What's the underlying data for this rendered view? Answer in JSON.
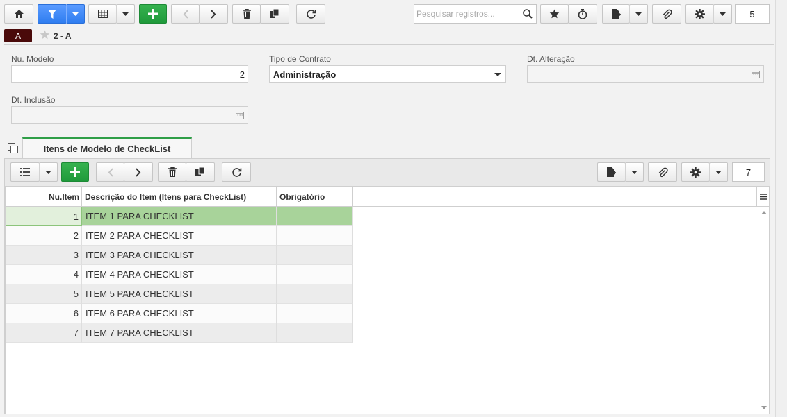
{
  "toolbar": {
    "search_placeholder": "Pesquisar registros...",
    "record_count": "5"
  },
  "record": {
    "tag": "A",
    "title": "2 - A"
  },
  "form": {
    "nu_modelo_label": "Nu. Modelo",
    "nu_modelo_value": "2",
    "tipo_contrato_label": "Tipo de Contrato",
    "tipo_contrato_value": "Administração",
    "dt_alteracao_label": "Dt. Alteração",
    "dt_alteracao_value": "",
    "dt_inclusao_label": "Dt. Inclusão",
    "dt_inclusao_value": ""
  },
  "subtab": {
    "label": "Itens de Modelo de CheckList",
    "record_count": "7"
  },
  "grid": {
    "columns": [
      "Nu.Item",
      "Descrição do Item (Itens para CheckList)",
      "Obrigatório"
    ],
    "rows": [
      {
        "num": "1",
        "desc": "ITEM 1 PARA CHECKLIST",
        "obrig": ""
      },
      {
        "num": "2",
        "desc": "ITEM 2 PARA CHECKLIST",
        "obrig": ""
      },
      {
        "num": "3",
        "desc": "ITEM 3 PARA CHECKLIST",
        "obrig": ""
      },
      {
        "num": "4",
        "desc": "ITEM 4 PARA CHECKLIST",
        "obrig": ""
      },
      {
        "num": "5",
        "desc": "ITEM 5 PARA CHECKLIST",
        "obrig": ""
      },
      {
        "num": "6",
        "desc": "ITEM 6 PARA CHECKLIST",
        "obrig": ""
      },
      {
        "num": "7",
        "desc": "ITEM 7 PARA CHECKLIST",
        "obrig": ""
      }
    ]
  },
  "colors": {
    "add_green": "#1f9a3b",
    "filter_blue": "#2f7df0",
    "tab_accent": "#2e9e47",
    "selected_row": "#a8d39a",
    "tag_bg": "#4a0a0a"
  }
}
